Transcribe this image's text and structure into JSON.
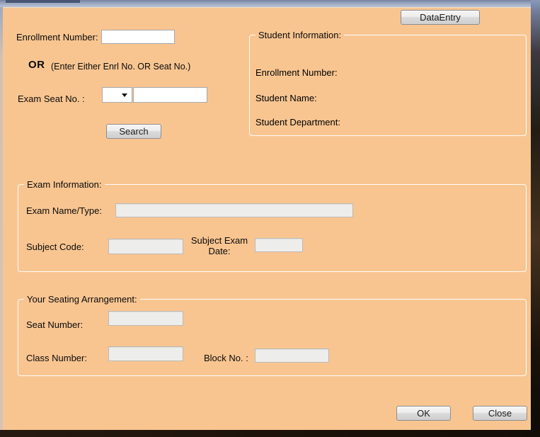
{
  "colors": {
    "form_background": "#F8C591",
    "groupbox_border": "#FCFCFA",
    "button_border": "#8D8D8D",
    "enabled_field_background": "#FFFFFF",
    "readonly_field_background": "#EDEDEB",
    "desktop_edge_dark": "#1A120C",
    "window_frame_blue": "#9AA6BF"
  },
  "toolbar": {
    "data_entry_label": "DataEntry"
  },
  "search_section": {
    "enrollment_label": "Enrollment Number:",
    "enrollment_value": "",
    "or_label": "OR",
    "or_hint": "(Enter Either Enrl No. OR Seat No.)",
    "exam_seat_label": "Exam Seat No. :",
    "seat_prefix_value": "",
    "seat_number_value": "",
    "search_button_label": "Search"
  },
  "student_info": {
    "title": "Student Information:",
    "fields": [
      {
        "label": "Enrollment Number:"
      },
      {
        "label": "Student Name:"
      },
      {
        "label": "Student Department:"
      }
    ]
  },
  "exam_info": {
    "title": "Exam Information:",
    "exam_name_label": "Exam Name/Type:",
    "exam_name_value": "",
    "subject_code_label": "Subject Code:",
    "subject_code_value": "",
    "subject_exam_date_label": "Subject Exam Date:",
    "subject_exam_date_value": ""
  },
  "seating": {
    "title": "Your Seating Arrangement:",
    "seat_number_label": "Seat Number:",
    "seat_number_value": "",
    "class_number_label": "Class Number:",
    "class_number_value": "",
    "block_no_label": "Block No. :",
    "block_no_value": ""
  },
  "footer": {
    "ok_label": "OK",
    "close_label": "Close"
  }
}
